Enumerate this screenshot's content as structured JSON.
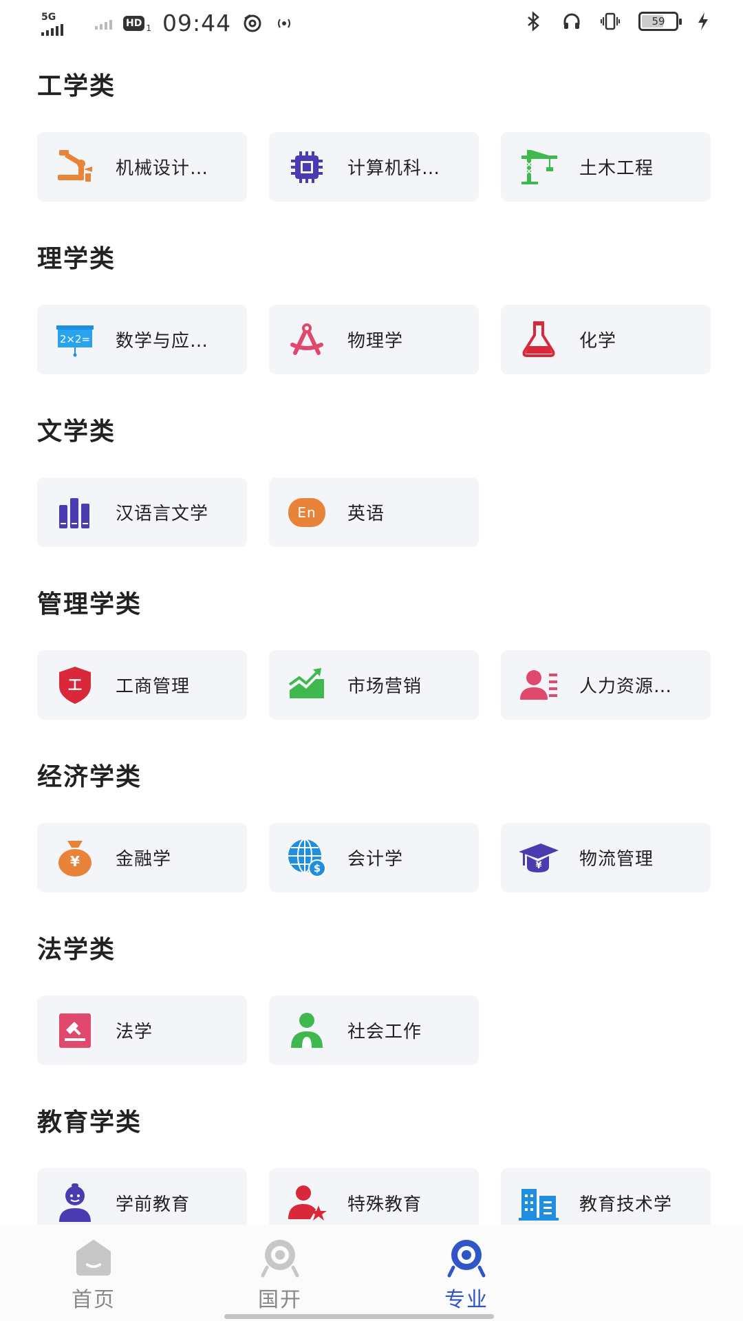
{
  "status_bar": {
    "network": "5G",
    "hd": "HD",
    "hd_sub": "1",
    "time": "09:44",
    "battery": "59"
  },
  "sections": [
    {
      "title": "工学类",
      "items": [
        {
          "label": "机械设计…",
          "icon": "robot-arm-icon"
        },
        {
          "label": "计算机科…",
          "icon": "chip-icon"
        },
        {
          "label": "土木工程",
          "icon": "crane-icon"
        }
      ]
    },
    {
      "title": "理学类",
      "items": [
        {
          "label": "数学与应…",
          "icon": "math-board-icon"
        },
        {
          "label": "物理学",
          "icon": "compass-icon"
        },
        {
          "label": "化学",
          "icon": "flask-icon"
        }
      ]
    },
    {
      "title": "文学类",
      "items": [
        {
          "label": "汉语言文学",
          "icon": "books-icon"
        },
        {
          "label": "英语",
          "icon": "english-icon",
          "icon_text": "En"
        }
      ]
    },
    {
      "title": "管理学类",
      "items": [
        {
          "label": "工商管理",
          "icon": "shield-icon",
          "icon_text": "工"
        },
        {
          "label": "市场营销",
          "icon": "trend-chart-icon"
        },
        {
          "label": "人力资源…",
          "icon": "person-list-icon"
        }
      ]
    },
    {
      "title": "经济学类",
      "items": [
        {
          "label": "金融学",
          "icon": "money-bag-icon",
          "icon_text": "¥"
        },
        {
          "label": "会计学",
          "icon": "globe-dollar-icon",
          "icon_text": "$"
        },
        {
          "label": "物流管理",
          "icon": "graduation-cap-icon",
          "icon_text": "¥"
        }
      ]
    },
    {
      "title": "法学类",
      "items": [
        {
          "label": "法学",
          "icon": "gavel-book-icon"
        },
        {
          "label": "社会工作",
          "icon": "social-worker-icon"
        }
      ]
    },
    {
      "title": "教育学类",
      "items": [
        {
          "label": "学前教育",
          "icon": "child-icon"
        },
        {
          "label": "特殊教育",
          "icon": "person-star-icon"
        },
        {
          "label": "教育技术学",
          "icon": "building-icon"
        }
      ]
    }
  ],
  "bottom_nav": {
    "items": [
      {
        "label": "首页",
        "icon": "home-icon"
      },
      {
        "label": "国开",
        "icon": "eye-icon"
      },
      {
        "label": "专业",
        "icon": "eye-icon-active"
      }
    ],
    "active_index": 2,
    "active_color": "#3055c6",
    "inactive_color": "#888888"
  }
}
